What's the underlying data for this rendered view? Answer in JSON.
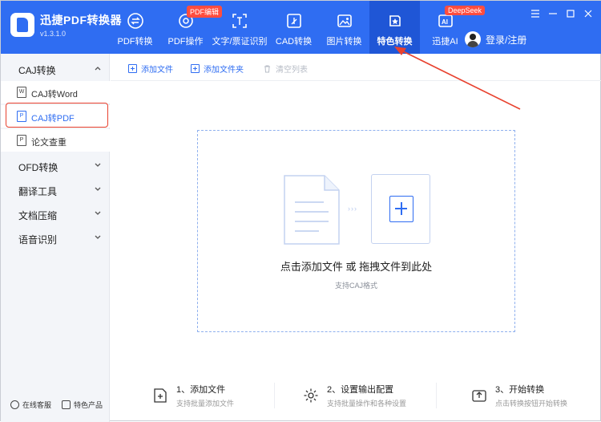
{
  "app": {
    "title": "迅捷PDF转换器",
    "version": "v1.3.1.0"
  },
  "nav": [
    {
      "label": "PDF转换",
      "icon": "pdf-convert-icon"
    },
    {
      "label": "PDF操作",
      "icon": "pdf-operate-icon",
      "badge": "PDF编辑"
    },
    {
      "label": "文字/票证识别",
      "icon": "ocr-icon"
    },
    {
      "label": "CAD转换",
      "icon": "cad-icon"
    },
    {
      "label": "图片转换",
      "icon": "image-icon"
    },
    {
      "label": "特色转换",
      "icon": "special-icon",
      "active": true
    },
    {
      "label": "迅捷AI",
      "icon": "ai-icon",
      "badge": "DeepSeek"
    }
  ],
  "user": {
    "label": "登录/注册"
  },
  "sidebar": {
    "sections": [
      {
        "label": "CAJ转换",
        "expanded": true
      },
      {
        "label": "OFD转换"
      },
      {
        "label": "翻译工具"
      },
      {
        "label": "文档压缩"
      },
      {
        "label": "语音识别"
      }
    ],
    "caj_items": [
      {
        "label": "CAJ转Word",
        "icon": "word-file-icon",
        "glyph": "W"
      },
      {
        "label": "CAJ转PDF",
        "icon": "pdf-file-icon",
        "glyph": "P",
        "selected": true
      },
      {
        "label": "论文查重",
        "icon": "paper-check-icon",
        "glyph": "P"
      }
    ],
    "footer": {
      "service": "在线客服",
      "products": "特色产品"
    }
  },
  "toolbar": {
    "add_file": "添加文件",
    "add_folder": "添加文件夹",
    "clear_list": "清空列表"
  },
  "dropzone": {
    "main_text": "点击添加文件 或 拖拽文件到此处",
    "sub_text": "支持CAJ格式"
  },
  "steps": [
    {
      "title": "1、添加文件",
      "desc": "支持批量添加文件"
    },
    {
      "title": "2、设置输出配置",
      "desc": "支持批量操作和各种设置"
    },
    {
      "title": "3、开始转换",
      "desc": "点击转换按钮开始转换"
    }
  ],
  "colors": {
    "primary": "#2f6df2",
    "active_nav": "#1f56d6",
    "badge": "#ff4d3f",
    "annotation": "#e8412e"
  }
}
